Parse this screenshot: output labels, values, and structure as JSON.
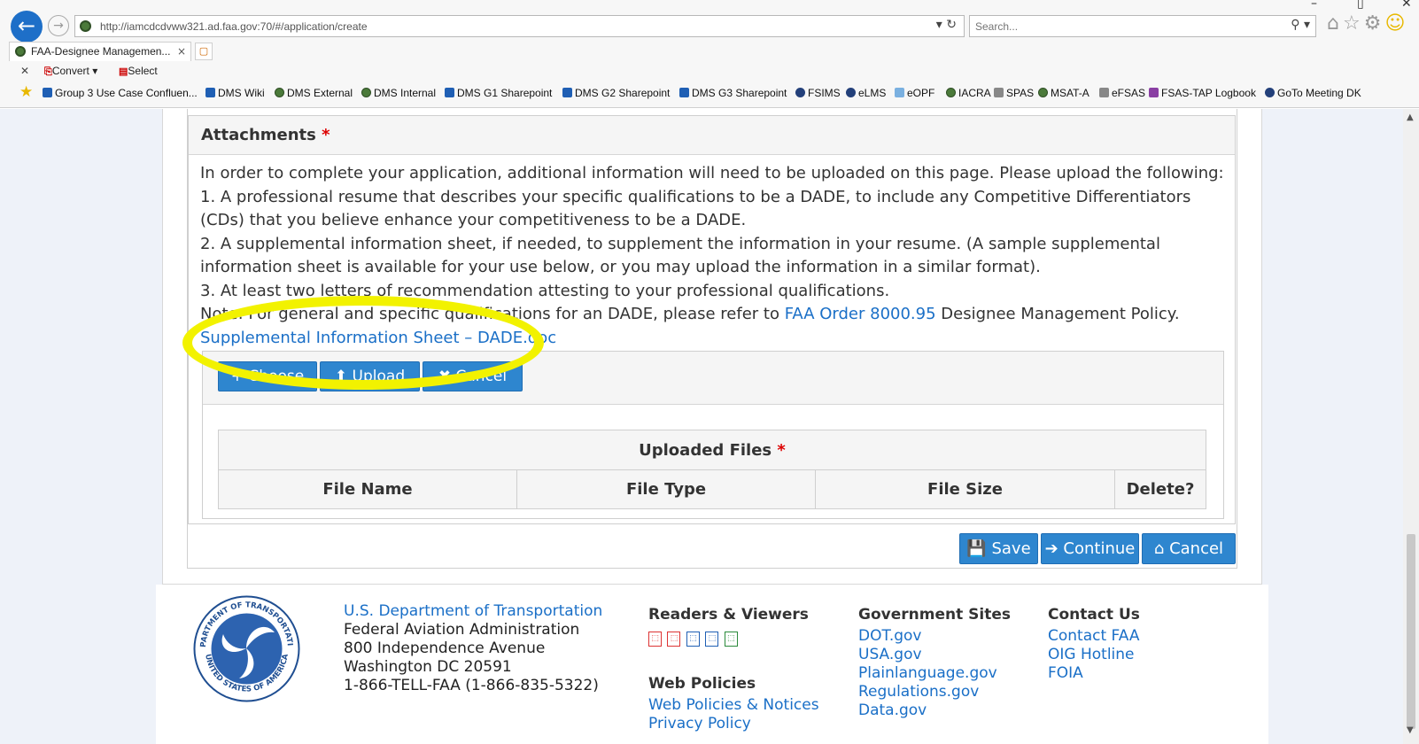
{
  "browser": {
    "address_url": "http://iamcdcdvww321.ad.faa.gov:70/#/application/create",
    "search_placeholder": "Search...",
    "tab_title": "FAA-Designee Managemen...",
    "tab_close": "×",
    "toolbar_convert": "Convert",
    "toolbar_select": "Select",
    "favorites": [
      "Group 3 Use Case Confluen...",
      "DMS Wiki",
      "DMS External",
      "DMS Internal",
      "DMS G1 Sharepoint",
      "DMS G2 Sharepoint",
      "DMS G3 Sharepoint",
      "FSIMS",
      "eLMS",
      "eOPF",
      "IACRA",
      "SPAS",
      "MSAT-A",
      "eFSAS",
      "FSAS-TAP Logbook",
      "GoTo Meeting DK"
    ]
  },
  "attachments": {
    "title": "Attachments",
    "required_mark": "*",
    "intro": "In order to complete your application, additional information will need to be uploaded on this page. Please upload the following:",
    "item1": "1. A professional resume that describes your specific qualifications to be a DADE, to include any Competitive Differentiators (CDs) that you believe enhance your competitiveness to be a DADE.",
    "item2": "2. A supplemental information sheet, if needed, to supplement the information in your resume. (A sample supplemental information sheet is available for your use below, or you may upload the information in a similar format).",
    "item3": "3. At least two letters of recommendation attesting to your professional qualifications.",
    "note_prefix": "Note: For general and specific qualifications for an DADE, please refer to",
    "note_link": "FAA Order 8000.95",
    "note_suffix": "Designee Management Policy.",
    "sheet_link": "Supplemental Information Sheet – DADE.doc",
    "choose_label": "+ Choose",
    "upload_label": "⬆ Upload",
    "cancel_label": "✖ Cancel",
    "files_title": "Uploaded Files",
    "columns": [
      "File Name",
      "File Type",
      "File Size",
      "Delete?"
    ]
  },
  "actions": {
    "save": "💾 Save",
    "continue": "➔ Continue",
    "cancel": "⌂ Cancel"
  },
  "footer": {
    "dot_link": "U.S. Department of Transportation",
    "address_lines": [
      "Federal Aviation Administration",
      "800 Independence Avenue",
      "Washington DC 20591",
      "1-866-TELL-FAA (1-866-835-5322)"
    ],
    "readers_title": "Readers & Viewers",
    "web_policies_title": "Web Policies",
    "web_policies_links": [
      "Web Policies & Notices",
      "Privacy Policy"
    ],
    "gov_sites_title": "Government Sites",
    "gov_sites": [
      "DOT.gov",
      "USA.gov",
      "Plainlanguage.gov",
      "Regulations.gov",
      "Data.gov"
    ],
    "contact_title": "Contact Us",
    "contact_links": [
      "Contact FAA",
      "OIG Hotline",
      "FOIA"
    ],
    "seal_top_text": "DEPARTMENT OF TRANSPORTATION",
    "seal_bottom_text": "UNITED STATES OF AMERICA"
  },
  "colors": {
    "accent_blue": "#2e86cf",
    "link_blue": "#1a6fc7",
    "highlight_yellow": "#f2f200",
    "required_red": "#d00000"
  }
}
